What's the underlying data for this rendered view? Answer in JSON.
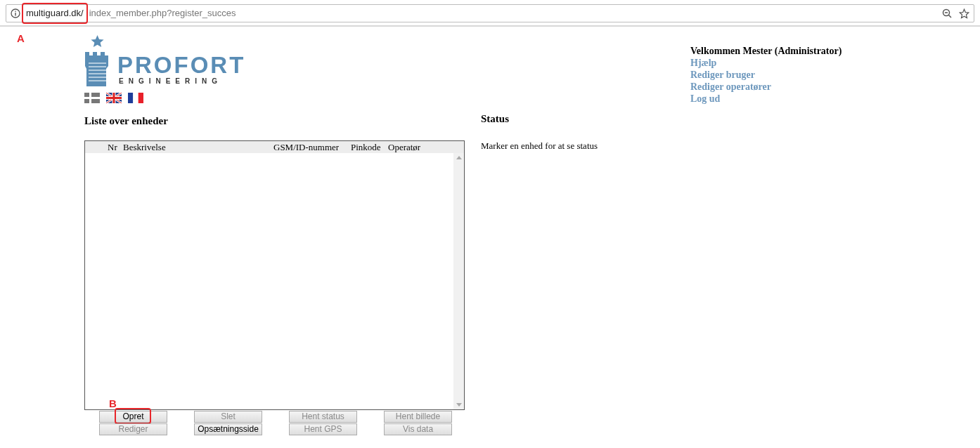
{
  "address_bar": {
    "domain": "multiguard.dk/",
    "path": "index_member.php?register_succes"
  },
  "annotations": [
    {
      "label": "A"
    },
    {
      "label": "B"
    }
  ],
  "logo": {
    "name": "PROFORT",
    "tagline": "ENGINEERING"
  },
  "languages": [
    {
      "kind": "danish"
    },
    {
      "kind": "english"
    },
    {
      "kind": "french"
    }
  ],
  "user_menu": {
    "welcome": "Velkommen Mester (Administrator)",
    "links": [
      "Hjælp",
      "Rediger bruger",
      "Rediger operatører",
      "Log ud"
    ]
  },
  "device_list": {
    "title": "Liste over enheder",
    "columns": [
      "Nr",
      "Beskrivelse",
      "GSM/ID-nummer",
      "Pinkode",
      "Operatør"
    ]
  },
  "buttons": [
    [
      {
        "label": "Opret",
        "disabled": false
      },
      {
        "label": "Slet",
        "disabled": true
      },
      {
        "label": "Hent status",
        "disabled": true
      },
      {
        "label": "Hent billede",
        "disabled": true
      }
    ],
    [
      {
        "label": "Rediger",
        "disabled": true
      },
      {
        "label": "Opsætningsside",
        "disabled": false
      },
      {
        "label": "Hent GPS",
        "disabled": true
      },
      {
        "label": "Vis data",
        "disabled": true
      }
    ]
  ],
  "status": {
    "title": "Status",
    "message": "Marker en enhed for at se status"
  }
}
